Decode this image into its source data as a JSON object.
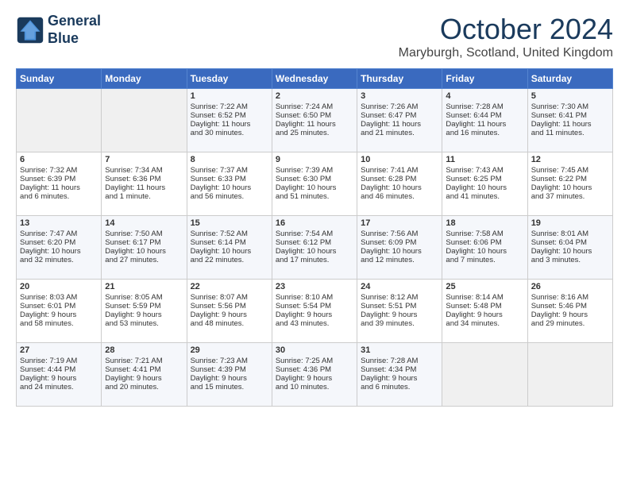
{
  "header": {
    "logo_line1": "General",
    "logo_line2": "Blue",
    "title": "October 2024",
    "location": "Maryburgh, Scotland, United Kingdom"
  },
  "columns": [
    "Sunday",
    "Monday",
    "Tuesday",
    "Wednesday",
    "Thursday",
    "Friday",
    "Saturday"
  ],
  "weeks": [
    [
      {
        "day": "",
        "info": ""
      },
      {
        "day": "",
        "info": ""
      },
      {
        "day": "1",
        "info": "Sunrise: 7:22 AM\nSunset: 6:52 PM\nDaylight: 11 hours\nand 30 minutes."
      },
      {
        "day": "2",
        "info": "Sunrise: 7:24 AM\nSunset: 6:50 PM\nDaylight: 11 hours\nand 25 minutes."
      },
      {
        "day": "3",
        "info": "Sunrise: 7:26 AM\nSunset: 6:47 PM\nDaylight: 11 hours\nand 21 minutes."
      },
      {
        "day": "4",
        "info": "Sunrise: 7:28 AM\nSunset: 6:44 PM\nDaylight: 11 hours\nand 16 minutes."
      },
      {
        "day": "5",
        "info": "Sunrise: 7:30 AM\nSunset: 6:41 PM\nDaylight: 11 hours\nand 11 minutes."
      }
    ],
    [
      {
        "day": "6",
        "info": "Sunrise: 7:32 AM\nSunset: 6:39 PM\nDaylight: 11 hours\nand 6 minutes."
      },
      {
        "day": "7",
        "info": "Sunrise: 7:34 AM\nSunset: 6:36 PM\nDaylight: 11 hours\nand 1 minute."
      },
      {
        "day": "8",
        "info": "Sunrise: 7:37 AM\nSunset: 6:33 PM\nDaylight: 10 hours\nand 56 minutes."
      },
      {
        "day": "9",
        "info": "Sunrise: 7:39 AM\nSunset: 6:30 PM\nDaylight: 10 hours\nand 51 minutes."
      },
      {
        "day": "10",
        "info": "Sunrise: 7:41 AM\nSunset: 6:28 PM\nDaylight: 10 hours\nand 46 minutes."
      },
      {
        "day": "11",
        "info": "Sunrise: 7:43 AM\nSunset: 6:25 PM\nDaylight: 10 hours\nand 41 minutes."
      },
      {
        "day": "12",
        "info": "Sunrise: 7:45 AM\nSunset: 6:22 PM\nDaylight: 10 hours\nand 37 minutes."
      }
    ],
    [
      {
        "day": "13",
        "info": "Sunrise: 7:47 AM\nSunset: 6:20 PM\nDaylight: 10 hours\nand 32 minutes."
      },
      {
        "day": "14",
        "info": "Sunrise: 7:50 AM\nSunset: 6:17 PM\nDaylight: 10 hours\nand 27 minutes."
      },
      {
        "day": "15",
        "info": "Sunrise: 7:52 AM\nSunset: 6:14 PM\nDaylight: 10 hours\nand 22 minutes."
      },
      {
        "day": "16",
        "info": "Sunrise: 7:54 AM\nSunset: 6:12 PM\nDaylight: 10 hours\nand 17 minutes."
      },
      {
        "day": "17",
        "info": "Sunrise: 7:56 AM\nSunset: 6:09 PM\nDaylight: 10 hours\nand 12 minutes."
      },
      {
        "day": "18",
        "info": "Sunrise: 7:58 AM\nSunset: 6:06 PM\nDaylight: 10 hours\nand 7 minutes."
      },
      {
        "day": "19",
        "info": "Sunrise: 8:01 AM\nSunset: 6:04 PM\nDaylight: 10 hours\nand 3 minutes."
      }
    ],
    [
      {
        "day": "20",
        "info": "Sunrise: 8:03 AM\nSunset: 6:01 PM\nDaylight: 9 hours\nand 58 minutes."
      },
      {
        "day": "21",
        "info": "Sunrise: 8:05 AM\nSunset: 5:59 PM\nDaylight: 9 hours\nand 53 minutes."
      },
      {
        "day": "22",
        "info": "Sunrise: 8:07 AM\nSunset: 5:56 PM\nDaylight: 9 hours\nand 48 minutes."
      },
      {
        "day": "23",
        "info": "Sunrise: 8:10 AM\nSunset: 5:54 PM\nDaylight: 9 hours\nand 43 minutes."
      },
      {
        "day": "24",
        "info": "Sunrise: 8:12 AM\nSunset: 5:51 PM\nDaylight: 9 hours\nand 39 minutes."
      },
      {
        "day": "25",
        "info": "Sunrise: 8:14 AM\nSunset: 5:48 PM\nDaylight: 9 hours\nand 34 minutes."
      },
      {
        "day": "26",
        "info": "Sunrise: 8:16 AM\nSunset: 5:46 PM\nDaylight: 9 hours\nand 29 minutes."
      }
    ],
    [
      {
        "day": "27",
        "info": "Sunrise: 7:19 AM\nSunset: 4:44 PM\nDaylight: 9 hours\nand 24 minutes."
      },
      {
        "day": "28",
        "info": "Sunrise: 7:21 AM\nSunset: 4:41 PM\nDaylight: 9 hours\nand 20 minutes."
      },
      {
        "day": "29",
        "info": "Sunrise: 7:23 AM\nSunset: 4:39 PM\nDaylight: 9 hours\nand 15 minutes."
      },
      {
        "day": "30",
        "info": "Sunrise: 7:25 AM\nSunset: 4:36 PM\nDaylight: 9 hours\nand 10 minutes."
      },
      {
        "day": "31",
        "info": "Sunrise: 7:28 AM\nSunset: 4:34 PM\nDaylight: 9 hours\nand 6 minutes."
      },
      {
        "day": "",
        "info": ""
      },
      {
        "day": "",
        "info": ""
      }
    ]
  ]
}
